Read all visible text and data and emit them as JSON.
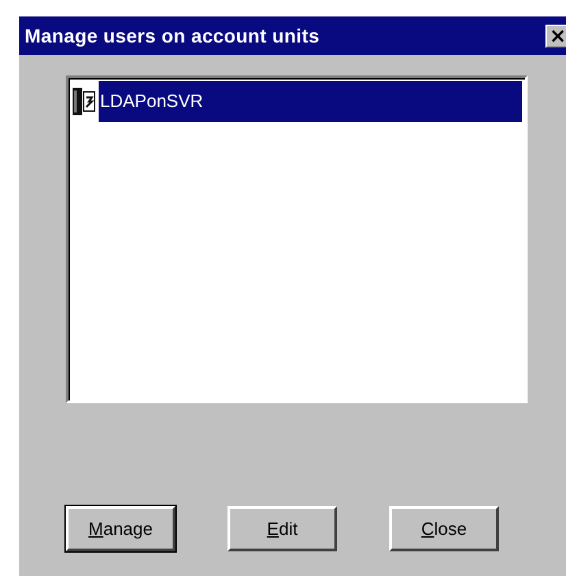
{
  "window": {
    "title": "Manage users on account units",
    "close": "×"
  },
  "list": {
    "items": [
      {
        "label": "LDAPonSVR",
        "selected": true
      }
    ]
  },
  "buttons": [
    {
      "label": "Manage",
      "default": true
    },
    {
      "label": "Edit",
      "default": false
    },
    {
      "label": "Close",
      "default": false
    }
  ]
}
